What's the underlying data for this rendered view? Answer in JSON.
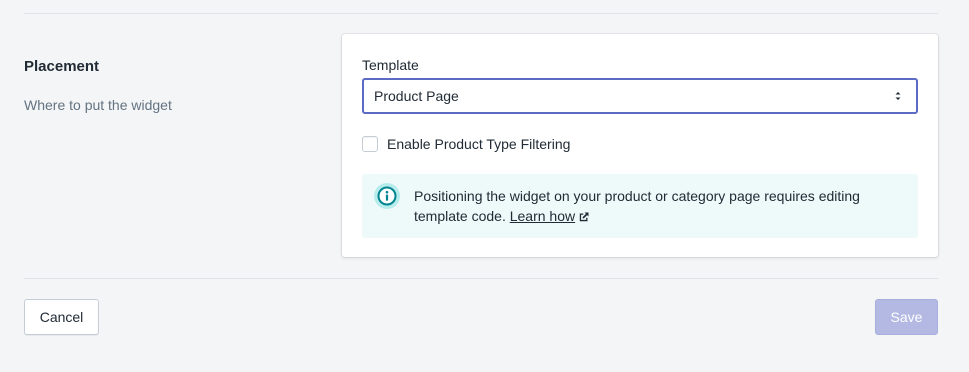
{
  "section": {
    "title": "Placement",
    "description": "Where to put the widget"
  },
  "template_field": {
    "label": "Template",
    "selected": "Product Page"
  },
  "filtering_checkbox": {
    "label": "Enable Product Type Filtering",
    "checked": false
  },
  "banner": {
    "text": "Positioning the widget on your product or category page requires editing template code.",
    "link_label": "Learn how",
    "icon": "info-icon",
    "link_icon": "external-link-icon"
  },
  "actions": {
    "cancel_label": "Cancel",
    "save_label": "Save",
    "save_disabled": true
  },
  "colors": {
    "accent": "#5c6ac4",
    "banner_bg": "#eef9f9",
    "info_icon": "#47c1bf",
    "save_disabled_bg": "#b3b9e3"
  }
}
